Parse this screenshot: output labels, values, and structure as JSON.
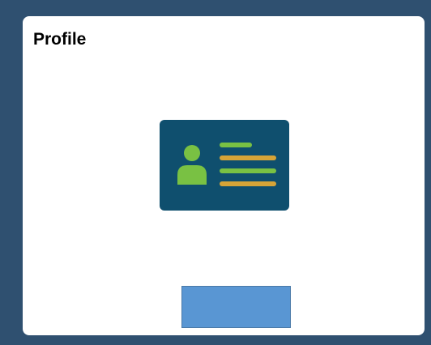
{
  "tile": {
    "title": "Profile",
    "icon": "id-card-icon",
    "action_button_label": ""
  },
  "colors": {
    "page_background": "#2f5070",
    "tile_background": "#ffffff",
    "icon_card": "#0f4f6e",
    "icon_person": "#79c143",
    "icon_line_green": "#79c143",
    "icon_line_gold": "#d6a437",
    "button": "#5996d3"
  }
}
